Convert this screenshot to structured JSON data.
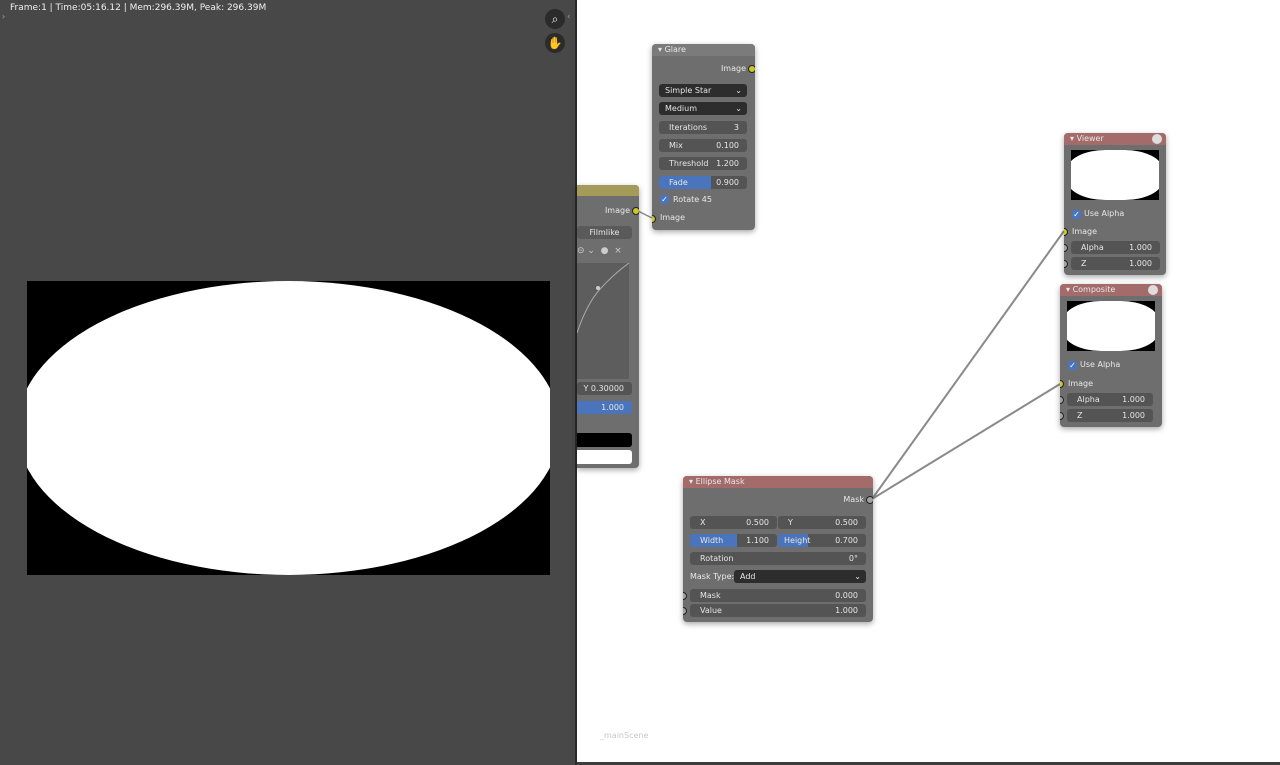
{
  "status_bar": {
    "text": "Frame:1 | Time:05:16.12 | Mem:296.39M, Peak: 296.39M"
  },
  "tools": {
    "zoom_icon": "zoom-icon",
    "pan_icon": "hand-icon"
  },
  "colors": {
    "editor_bg": "#ffffff",
    "render_bg": "#484848",
    "node_bg": "#6e6e6e",
    "accent_blue": "#4a75bd",
    "socket_yellow": "#c7c729",
    "socket_grey": "#a1a1a1"
  },
  "glare_node": {
    "title": "Glare",
    "output_label": "Image",
    "type_value": "Simple Star",
    "quality_value": "Medium",
    "iterations_label": "Iterations",
    "iterations_value": "3",
    "mix_label": "Mix",
    "mix_value": "0.100",
    "threshold_label": "Threshold",
    "threshold_value": "1.200",
    "fade_label": "Fade",
    "fade_value": "0.900",
    "rotate_label": "Rotate 45",
    "input_label": "Image"
  },
  "tonemap_node": {
    "output_label": "Image",
    "mode_value": "Filmlike",
    "y_value": "Y 0.30000",
    "fac_value": "1.000"
  },
  "viewer_node": {
    "title": "Viewer",
    "use_alpha_label": "Use Alpha",
    "input_label": "Image",
    "alpha_label": "Alpha",
    "alpha_value": "1.000",
    "z_label": "Z",
    "z_value": "1.000"
  },
  "composite_node": {
    "title": "Composite",
    "use_alpha_label": "Use Alpha",
    "input_label": "Image",
    "alpha_label": "Alpha",
    "alpha_value": "1.000",
    "z_label": "Z",
    "z_value": "1.000"
  },
  "ellipse_mask_node": {
    "title": "Ellipse Mask",
    "output_label": "Mask",
    "x_label": "X",
    "x_value": "0.500",
    "y_label": "Y",
    "y_value": "0.500",
    "width_label": "Width",
    "width_value": "1.100",
    "height_label": "Height",
    "height_value": "0.700",
    "rotation_label": "Rotation",
    "rotation_value": "0°",
    "mask_type_label": "Mask Type:",
    "mask_type_value": "Add",
    "mask_label": "Mask",
    "mask_value": "0.000",
    "value_label": "Value",
    "value_value": "1.000"
  },
  "scene_label": "_mainScene"
}
